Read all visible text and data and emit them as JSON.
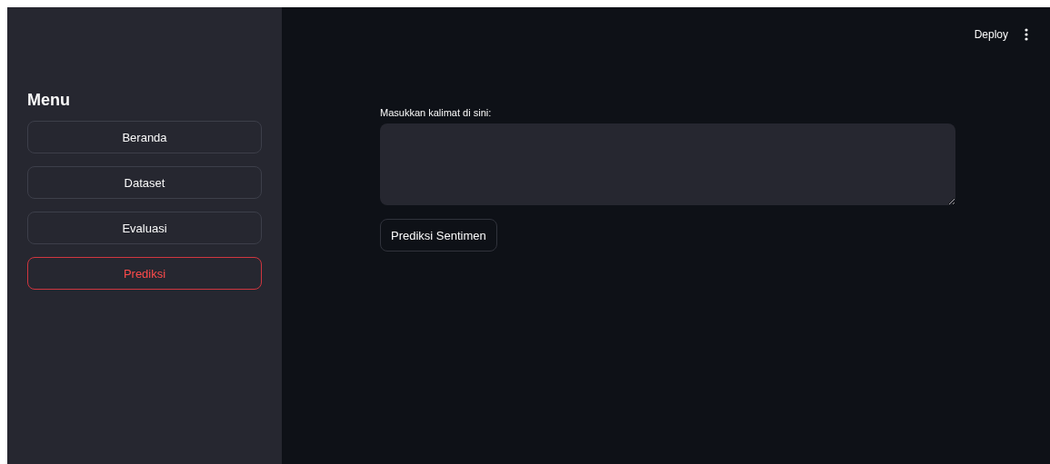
{
  "header": {
    "deploy": "Deploy"
  },
  "sidebar": {
    "title": "Menu",
    "items": [
      {
        "label": "Beranda",
        "selected": false
      },
      {
        "label": "Dataset",
        "selected": false
      },
      {
        "label": "Evaluasi",
        "selected": false
      },
      {
        "label": "Prediksi",
        "selected": true
      }
    ]
  },
  "form": {
    "label": "Masukkan kalimat di sini:",
    "button": "Prediksi Sentimen"
  }
}
